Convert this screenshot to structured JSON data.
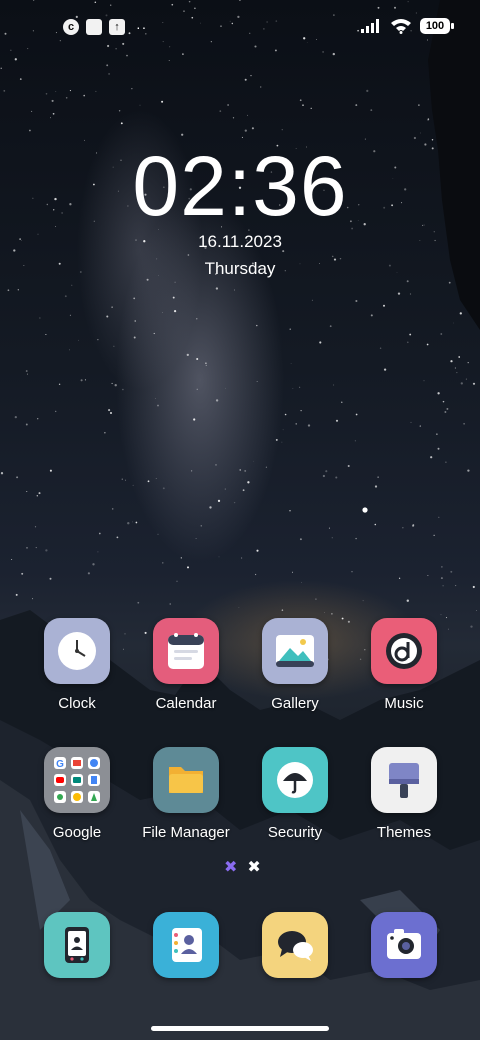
{
  "status_bar": {
    "left_icons": [
      "notification-c-icon",
      "square-notification-icon",
      "upload-notification-icon"
    ],
    "more_dots": "··",
    "battery_level": "100"
  },
  "lockscreen": {
    "time": "02:36",
    "date": "16.11.2023",
    "day": "Thursday"
  },
  "apps": [
    {
      "id": "clock",
      "label": "Clock",
      "icon": "clock-icon",
      "color": "#aab2d4"
    },
    {
      "id": "calendar",
      "label": "Calendar",
      "icon": "calendar-icon",
      "color": "#e45d7c"
    },
    {
      "id": "gallery",
      "label": "Gallery",
      "icon": "gallery-icon",
      "color": "#aab2d4"
    },
    {
      "id": "music",
      "label": "Music",
      "icon": "music-icon",
      "color": "#ea5e78"
    },
    {
      "id": "google",
      "label": "Google",
      "icon": "google-folder-icon",
      "color": "#8c8f95"
    },
    {
      "id": "file-manager",
      "label": "File Manager",
      "icon": "folder-icon",
      "color": "#5e8a96"
    },
    {
      "id": "security",
      "label": "Security",
      "icon": "umbrella-icon",
      "color": "#4ec5c6"
    },
    {
      "id": "themes",
      "label": "Themes",
      "icon": "paint-brush-icon",
      "color": "#f0f0f0"
    }
  ],
  "dock": [
    {
      "id": "phone",
      "icon": "phone-icon",
      "color": "#5ec5c0"
    },
    {
      "id": "contacts",
      "icon": "contacts-icon",
      "color": "#3ab1d8"
    },
    {
      "id": "messages",
      "icon": "messages-icon",
      "color": "#f4d47e"
    },
    {
      "id": "camera",
      "icon": "camera-icon",
      "color": "#6c6fd0"
    }
  ],
  "pager": {
    "current": 1,
    "total": 2
  }
}
